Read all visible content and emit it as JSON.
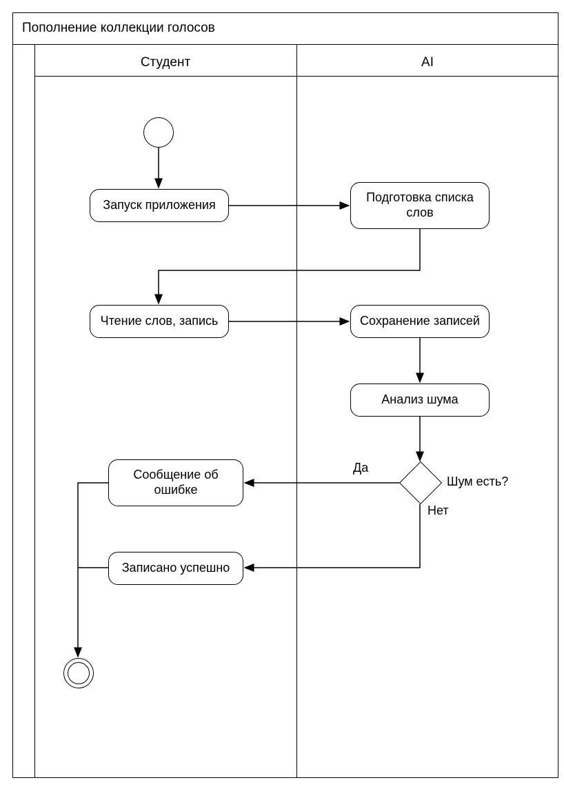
{
  "title": "Пополнение коллекции голосов",
  "lanes": {
    "student": "Студент",
    "ai": "AI"
  },
  "activities": {
    "launch_app": "Запуск приложения",
    "prepare_word_list": "Подготовка списка слов",
    "read_words_record": "Чтение слов, запись",
    "save_records": "Сохранение записей",
    "analyze_noise": "Анализ шума",
    "error_message": "Сообщение об ошибке",
    "recorded_success": "Записано успешно"
  },
  "decision": {
    "question": "Шум есть?",
    "yes": "Да",
    "no": "Нет"
  }
}
